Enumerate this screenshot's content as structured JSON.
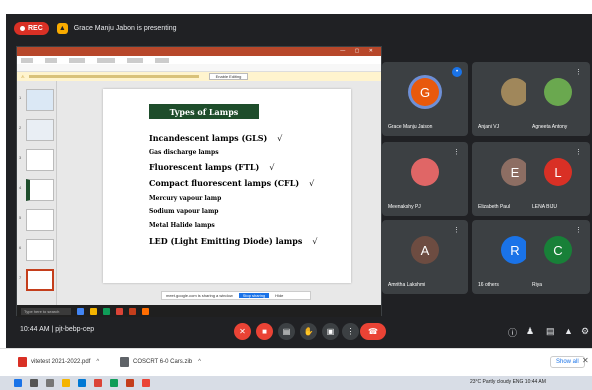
{
  "meet": {
    "recording_label": "REC",
    "presenting_text": "Grace Manju Jabon is presenting",
    "clock_text": "10:44 AM | pjt-bebp-cep"
  },
  "participants": [
    {
      "name": "Grace Manju Jaison",
      "initial": "G",
      "avatar_color": "#e8590c",
      "speaking": true
    },
    {
      "name": "Anjani VJ",
      "initial": "",
      "avatar_color": "#a0875b",
      "speaking": false
    },
    {
      "name": "Agneeta Antony",
      "initial": "",
      "avatar_color": "#6aa84f",
      "speaking": false
    },
    {
      "name": "Meenakshy PJ",
      "initial": "",
      "avatar_color": "#e06666",
      "speaking": false
    },
    {
      "name": "Elizabeth Paul",
      "initial": "E",
      "avatar_color": "#8d6e63",
      "speaking": false
    },
    {
      "name": "LENA BIJU",
      "initial": "L",
      "avatar_color": "#d93025",
      "speaking": false
    },
    {
      "name": "Amritha Lakshmi",
      "initial": "A",
      "avatar_color": "#6d4c41",
      "speaking": false
    },
    {
      "name": "16 others",
      "initial": "R",
      "avatar_color": "#1a73e8",
      "speaking": false
    },
    {
      "name": "Riya",
      "initial": "C",
      "avatar_color": "#188038",
      "speaking": false
    }
  ],
  "slide": {
    "title": "Types of Lamps",
    "items": [
      {
        "text": "Incandescent lamps (GLS)",
        "tick": "√",
        "size": 8
      },
      {
        "text": "Gas discharge lamps",
        "tick": "",
        "size": 6
      },
      {
        "text": "Fluorescent lamps (FTL)",
        "tick": "√",
        "size": 8
      },
      {
        "text": "Compact fluorescent lamps (CFL)",
        "tick": "√",
        "size": 8
      },
      {
        "text": "Mercury vapour lamp",
        "tick": "",
        "size": 6
      },
      {
        "text": "Sodium vapour lamp",
        "tick": "",
        "size": 6
      },
      {
        "text": "Metal Halide lamps",
        "tick": "",
        "size": 6
      },
      {
        "text": "LED (Light Emitting Diode) lamps",
        "tick": "√",
        "size": 8
      }
    ]
  },
  "screen_share": {
    "present_toolbar_text": "meet.google.com is sharing a window",
    "stop_sharing_label": "Stop sharing",
    "hide_label": "Hide",
    "warning_button": "Enable Editing",
    "search_placeholder": "Type here to search"
  },
  "downloads": [
    {
      "file": "vitetest 2021-2022.pdf",
      "icon": "pdf-icon"
    },
    {
      "file": "COSCRT 6-0 Cars.zib",
      "icon": "document-icon"
    }
  ],
  "downloads_bar": {
    "show_all": "Show all"
  },
  "taskbar": {
    "tray_text": "23°C  Partly cloudy  ENG  10:44 AM"
  }
}
